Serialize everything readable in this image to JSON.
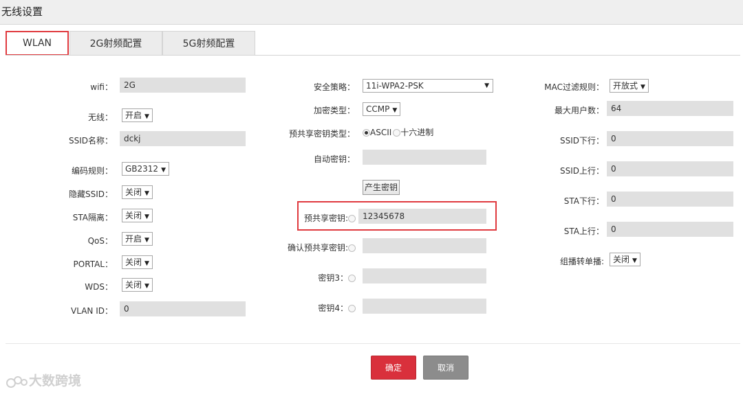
{
  "header": {
    "title": "无线设置"
  },
  "tabs": [
    {
      "label": "WLAN",
      "active": true
    },
    {
      "label": "2G射频配置",
      "active": false
    },
    {
      "label": "5G射频配置",
      "active": false
    }
  ],
  "left": {
    "wifi": {
      "label": "wifi：",
      "value": "2G"
    },
    "wireless": {
      "label": "无线：",
      "value": "开启"
    },
    "ssid": {
      "label": "SSID名称：",
      "value": "dckj"
    },
    "encoding": {
      "label": "编码规则：",
      "value": "GB2312"
    },
    "hide_ssid": {
      "label": "隐藏SSID：",
      "value": "关闭"
    },
    "sta_isolation": {
      "label": "STA隔离：",
      "value": "关闭"
    },
    "qos": {
      "label": "QoS：",
      "value": "开启"
    },
    "portal": {
      "label": "PORTAL：",
      "value": "关闭"
    },
    "wds": {
      "label": "WDS：",
      "value": "关闭"
    },
    "vlan_id": {
      "label": "VLAN ID：",
      "value": "0"
    }
  },
  "middle": {
    "security_policy": {
      "label": "安全策略：",
      "value": "11i-WPA2-PSK"
    },
    "encryption_type": {
      "label": "加密类型：",
      "value": "CCMP"
    },
    "psk_type": {
      "label": "预共享密钥类型：",
      "option_ascii": "ASCII",
      "option_hex": "十六进制",
      "selected": "ASCII"
    },
    "auto_key": {
      "label": "自动密钥：",
      "value": ""
    },
    "generate_button": "产生密钥",
    "psk": {
      "label": "预共享密钥:",
      "value": "12345678"
    },
    "confirm_psk": {
      "label": "确认预共享密钥:",
      "value": ""
    },
    "key3": {
      "label": "密钥3：",
      "value": ""
    },
    "key4": {
      "label": "密钥4：",
      "value": ""
    }
  },
  "right": {
    "mac_filter": {
      "label": "MAC过滤规则：",
      "value": "开放式"
    },
    "max_users": {
      "label": "最大用户数：",
      "value": "64"
    },
    "ssid_down": {
      "label": "SSID下行：",
      "value": "0"
    },
    "ssid_up": {
      "label": "SSID上行：",
      "value": "0"
    },
    "sta_down": {
      "label": "STA下行：",
      "value": "0"
    },
    "sta_up": {
      "label": "STA上行：",
      "value": "0"
    },
    "multicast_to_unicast": {
      "label": "组播转单播:",
      "value": "关闭"
    }
  },
  "actions": {
    "ok": "确定",
    "cancel": "取消"
  },
  "watermark": "大数跨境",
  "colors": {
    "accent_red": "#e0393e",
    "ok_button": "#d9303c",
    "cancel_button": "#8c8c8c",
    "input_bg": "#e0e0e0"
  }
}
